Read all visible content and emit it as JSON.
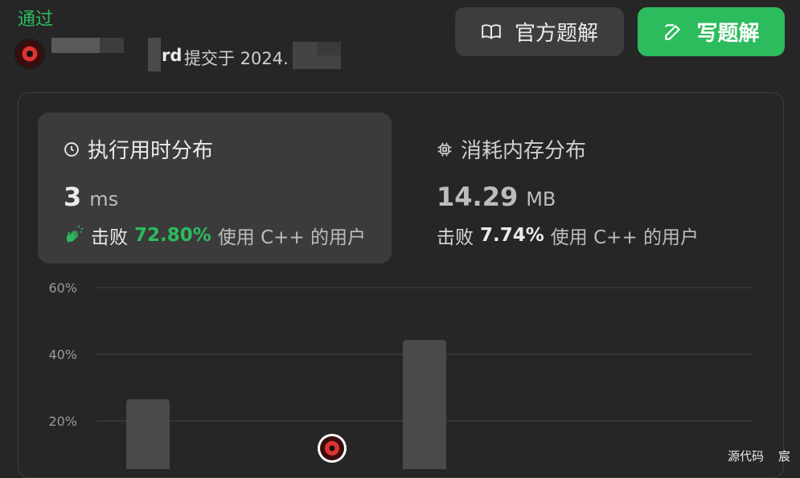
{
  "submission": {
    "status": "通过",
    "username_suffix": "rd",
    "submitted_text": "提交于 2024."
  },
  "buttons": {
    "official": "官方题解",
    "write": "写题解"
  },
  "runtime": {
    "title": "执行用时分布",
    "value": "3",
    "unit": "ms",
    "beats_label": "击败",
    "beats_pct": "72.80%",
    "beats_suffix": "使用 C++ 的用户"
  },
  "memory": {
    "title": "消耗内存分布",
    "value": "14.29",
    "unit": "MB",
    "beats_label": "击败",
    "beats_pct": "7.74%",
    "beats_suffix": "使用 C++ 的用户"
  },
  "chart_data": {
    "type": "bar",
    "y_ticks": [
      "60%",
      "40%",
      "20%"
    ],
    "ylim": [
      0,
      60
    ],
    "values": [
      26.5,
      44.3
    ],
    "colors": {
      "bar": "#4a4a4a",
      "grid": "#444444",
      "tick": "#9a9a9a"
    }
  },
  "footer": {
    "source_label": "源代码",
    "extra": "宸"
  },
  "colors": {
    "accent": "#2cbb5d",
    "bg": "#262626",
    "card": "#3b3b3b"
  }
}
